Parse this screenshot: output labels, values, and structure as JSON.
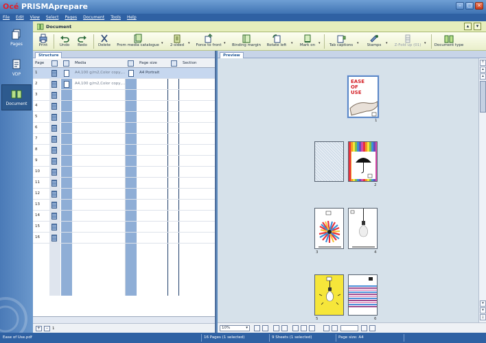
{
  "app": {
    "brand": "Océ",
    "name": "PRISMAprepare"
  },
  "window_controls": [
    "–",
    "□",
    "×"
  ],
  "menu": [
    "File",
    "Edit",
    "View",
    "Select",
    "Pages",
    "Document",
    "Tools",
    "Help"
  ],
  "nav": [
    {
      "label": "Pages",
      "icon": "pages-icon"
    },
    {
      "label": "VDP",
      "icon": "vdp-icon"
    },
    {
      "label": "Document",
      "icon": "document-icon",
      "active": true
    }
  ],
  "document_header": {
    "title": "Document"
  },
  "toolbar": {
    "print": "Print",
    "undo": "Undo",
    "redo": "Redo",
    "delete": "Delete",
    "from_media_catalogue": "From media catalogue",
    "two_sided": "2-sided",
    "force_to_front": "Force to front",
    "binding_margin": "Binding margin",
    "rotate_left": "Rotate left",
    "mark_on": "Mark on",
    "tab_captions": "Tab captions",
    "stamps": "Stamps",
    "z_fold_up": "Z-Fold up (01)",
    "document_type": "Document type"
  },
  "structure": {
    "tab": "Structure",
    "columns": {
      "page": "Page",
      "media": "Media",
      "page_size": "Page size",
      "section": "Section"
    },
    "rows": [
      {
        "num": "1",
        "media": "A4,100 g/m2,Color copy,...",
        "size": "A4 Portrait",
        "selected": true
      },
      {
        "num": "2",
        "media": "A4,100 g/m2,Color copy,...",
        "size": ""
      },
      {
        "num": "3",
        "media": "",
        "size": ""
      },
      {
        "num": "4",
        "media": "",
        "size": ""
      },
      {
        "num": "5",
        "media": "",
        "size": ""
      },
      {
        "num": "6",
        "media": "",
        "size": ""
      },
      {
        "num": "7",
        "media": "",
        "size": ""
      },
      {
        "num": "8",
        "media": "",
        "size": ""
      },
      {
        "num": "9",
        "media": "",
        "size": ""
      },
      {
        "num": "10",
        "media": "",
        "size": ""
      },
      {
        "num": "11",
        "media": "",
        "size": ""
      },
      {
        "num": "12",
        "media": "",
        "size": ""
      },
      {
        "num": "13",
        "media": "",
        "size": ""
      },
      {
        "num": "14",
        "media": "",
        "size": ""
      },
      {
        "num": "15",
        "media": "",
        "size": ""
      },
      {
        "num": "16",
        "media": "",
        "size": ""
      }
    ],
    "footer_value": "1"
  },
  "preview": {
    "tab": "Preview",
    "zoom": "10%",
    "cover_text": [
      "EASE",
      "OF",
      "USE"
    ],
    "sheets": [
      "1",
      "2",
      "3",
      "4",
      "5",
      "6"
    ]
  },
  "statusbar": {
    "file": "Ease of Use.pdf",
    "pages": "16 Pages (1 selected)",
    "sheets": "9 Sheets (1 selected)",
    "page_size": "Page size: A4"
  },
  "colors": {
    "brand_red": "#e61e28",
    "window_blue": "#2f61a3",
    "toolbar_cream": "#e9efca",
    "selection": "#c6d7ef"
  }
}
